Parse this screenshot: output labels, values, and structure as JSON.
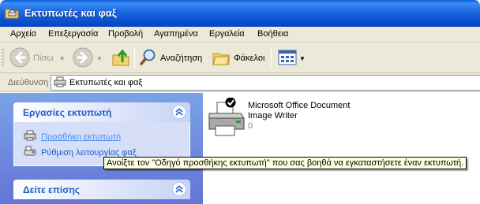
{
  "window": {
    "title": "Εκτυπωτές και φαξ"
  },
  "menu": [
    "Αρχείο",
    "Επεξεργασία",
    "Προβολή",
    "Αγαπημένα",
    "Εργαλεία",
    "Βοήθεια"
  ],
  "toolbar": {
    "back_label": "Πίσω",
    "search_label": "Αναζήτηση",
    "folders_label": "Φάκελοι"
  },
  "address": {
    "label": "Διεύθυνση",
    "value": "Εκτυπωτές και φαξ"
  },
  "tasks": {
    "printer_tasks": {
      "title": "Εργασίες εκτυπωτή",
      "items": [
        "Προσθήκη εκτυπωτή",
        "Ρύθμιση λειτουργίας φαξ"
      ]
    },
    "see_also": {
      "title": "Δείτε επίσης"
    }
  },
  "printers": [
    {
      "name_line1": "Microsoft Office Document",
      "name_line2": "Image Writer",
      "jobs": "0"
    }
  ],
  "tooltip": "Ανοίξτε τον \"Οδηγό προσθήκης εκτυπωτή\" που σας βοηθά να εγκαταστήσετε έναν εκτυπωτή.",
  "colors": {
    "title_bar": "#0a4fcf",
    "task_pane": "#6f8fe0",
    "link": "#215dc6",
    "tooltip_bg": "#ffffe1"
  }
}
